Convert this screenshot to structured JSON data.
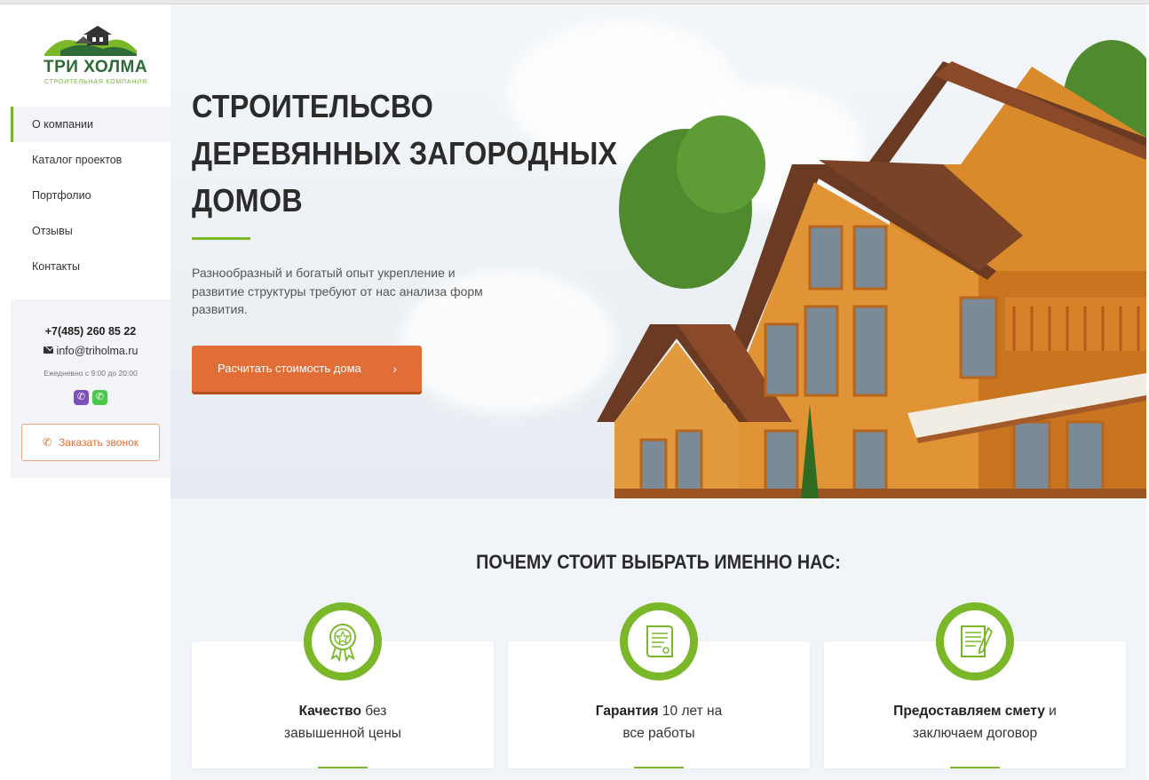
{
  "brand": {
    "name": "ТРИ ХОЛМА",
    "tagline": "СТРОИТЕЛЬНАЯ КОМПАНИЯ",
    "accent_color": "#7ab829",
    "cta_color": "#e16e36"
  },
  "sidebar": {
    "items": [
      {
        "label": "О компании",
        "active": true
      },
      {
        "label": "Каталог проектов"
      },
      {
        "label": "Портфолио"
      },
      {
        "label": "Отзывы"
      },
      {
        "label": "Контакты"
      }
    ],
    "contact": {
      "phone": "+7(485) 260 85 22",
      "email": "info@triholma.ru",
      "hours": "Ежедневно с 9:00 до 20:00",
      "messengers": [
        "viber-icon",
        "whatsapp-icon"
      ],
      "callback_label": "Заказать звонок"
    }
  },
  "hero": {
    "title_lines": [
      "СТРОИТЕЛЬСВО",
      "ДЕРЕВЯННЫХ ЗАГОРОДНЫХ",
      "ДОМОВ"
    ],
    "text": "Разнообразный и богатый опыт укрепление и развитие структуры требуют от нас анализа форм развития.",
    "button_label": "Расчитать стоимость дома",
    "button_icon": "chevron-right-icon"
  },
  "why": {
    "title": "ПОЧЕМУ СТОИТ ВЫБРАТЬ ИМЕННО НАС:",
    "cards": [
      {
        "icon": "award-medal-icon",
        "bold": "Качество",
        "rest1": " без",
        "line2": "завышенной цены"
      },
      {
        "icon": "certificate-scroll-icon",
        "bold": "Гарантия",
        "rest1": " 10 лет на",
        "line2": "все работы"
      },
      {
        "icon": "contract-document-icon",
        "bold": "Предоставляем смету",
        "rest1": " и",
        "line2": "заключаем договор"
      }
    ]
  }
}
